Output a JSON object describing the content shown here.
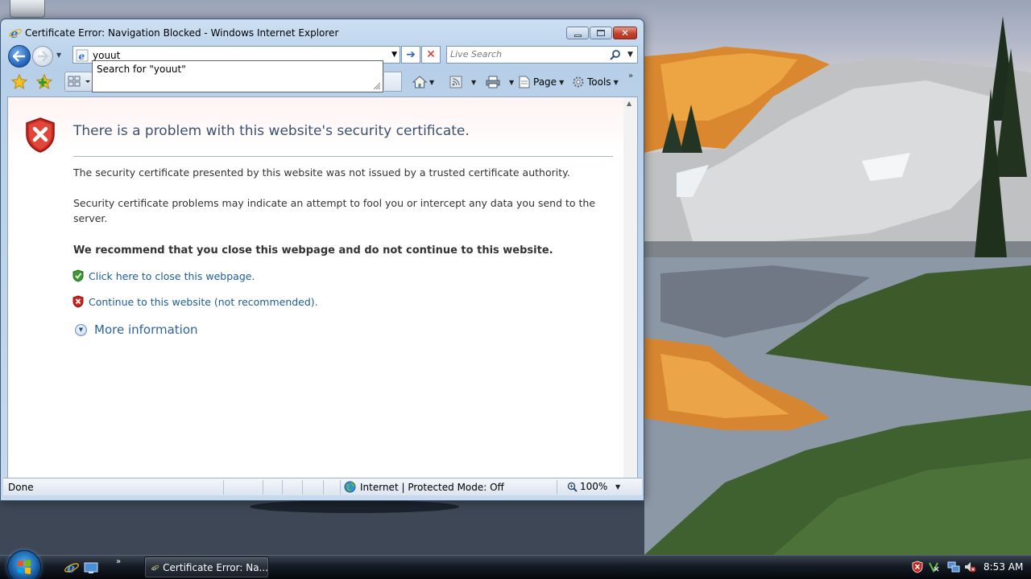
{
  "window": {
    "title": "Certificate Error: Navigation Blocked - Windows Internet Explorer"
  },
  "address_bar": {
    "value": "youut"
  },
  "autocomplete": {
    "suggestion": "Search for \"youut\""
  },
  "search": {
    "placeholder": "Live Search"
  },
  "command_bar": {
    "page_label": "Page",
    "tools_label": "Tools"
  },
  "page": {
    "title": "There is a problem with this website's security certificate.",
    "paragraph1": "The security certificate presented by this website was not issued by a trusted certificate authority.",
    "paragraph2": "Security certificate problems may indicate an attempt to fool you or intercept any data you send to the server.",
    "recommendation": "We recommend that you close this webpage and do not continue to this website.",
    "close_link": "Click here to close this webpage.",
    "continue_link": "Continue to this website (not recommended).",
    "more_info": "More information"
  },
  "status_bar": {
    "status": "Done",
    "zone": "Internet | Protected Mode: Off",
    "zoom": "100%"
  },
  "taskbar": {
    "task_button": "Certificate Error: Na...",
    "clock": "8:53 AM"
  },
  "colors": {
    "link": "#1b5c9a",
    "title": "#3a5270",
    "error_red": "#c8261e",
    "safe_green": "#3a9a2f"
  },
  "icons": {
    "back": "back-arrow-icon",
    "forward": "forward-arrow-icon",
    "go": "go-arrow-icon",
    "stop": "stop-x-icon",
    "search": "magnifier-icon",
    "favorites": "star-icon",
    "add_favorites": "add-star-icon",
    "home": "home-icon",
    "feeds": "rss-icon",
    "print": "printer-icon",
    "page": "page-icon",
    "tools": "gear-icon",
    "error_shield": "red-shield-x-icon",
    "safe_shield": "green-shield-check-icon",
    "globe": "globe-icon",
    "zoom": "zoom-magnifier-icon"
  }
}
